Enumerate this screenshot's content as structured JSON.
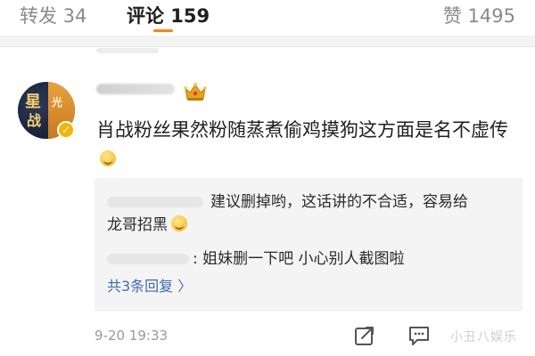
{
  "tabs": {
    "repost": "转发 34",
    "comments": "评论 159",
    "likes": "赞 1495"
  },
  "comment": {
    "text": "肖战粉丝果然粉随蒸煮偷鸡摸狗这方面是名不虚传",
    "avatar_text": [
      "星",
      "战",
      "光"
    ],
    "verified_badge": "✓",
    "replies": {
      "reply1_line1": "建议删掉哟，这话讲的不合适，容易给",
      "reply1_line2": "龙哥招黑",
      "reply2": ": 姐妹删一下吧 小心别人截图啦",
      "more_link": "共3条回复 〉"
    },
    "timestamp": "9-20 19:33"
  },
  "watermark": "小丑八娱乐",
  "colors": {
    "accent": "#ff8200",
    "link": "#3d6bb3",
    "crown": "#e8a21d"
  },
  "icons": [
    "crown-icon",
    "verified-icon",
    "emoji-icon",
    "share-icon",
    "comment-icon"
  ]
}
